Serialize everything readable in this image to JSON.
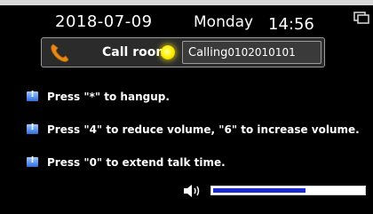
{
  "header": {
    "date": "2018-07-09",
    "day": "Monday",
    "time": "14:56"
  },
  "call": {
    "room_label": "Call room",
    "status_text": "Calling",
    "number": "0102010101",
    "status_color": "#ffee00"
  },
  "instructions": [
    "Press \"*\" to hangup.",
    "Press \"4\" to reduce volume, \"6\" to increase volume.",
    "Press \"0\" to extend talk time."
  ],
  "volume": {
    "level": 0.6
  },
  "icons": [
    "phone-icon",
    "info-icon",
    "speaker-icon",
    "window-icon"
  ],
  "colors": {
    "accent_blue": "#1a2bcf",
    "phone_orange": "#e38a1b"
  }
}
